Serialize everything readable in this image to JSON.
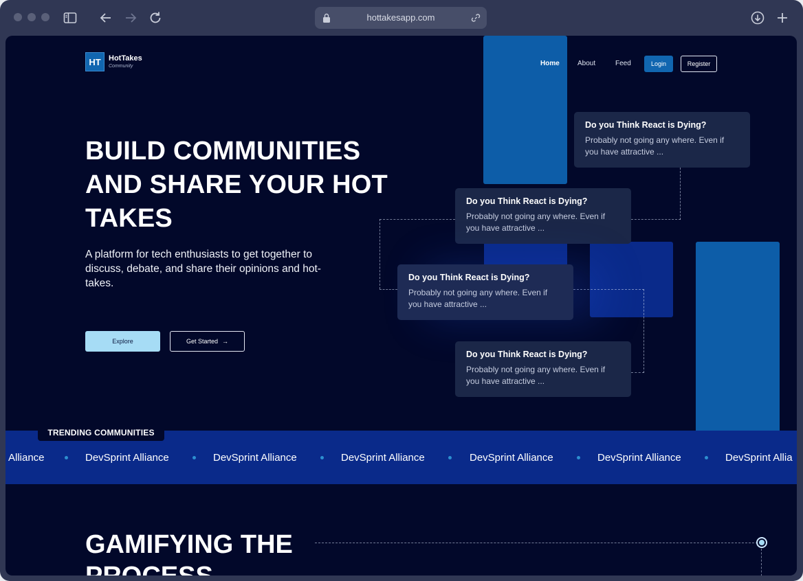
{
  "browser": {
    "url": "hottakesapp.com",
    "icons": [
      "sidebar-icon",
      "back-icon",
      "forward-icon",
      "reload-icon",
      "lock-icon",
      "link-icon",
      "download-icon",
      "new-tab-icon"
    ]
  },
  "header": {
    "logo_mark": "HT",
    "logo_name": "HotTakes",
    "logo_sub": "Community",
    "nav": [
      {
        "label": "Home",
        "active": true
      },
      {
        "label": "About",
        "active": false
      },
      {
        "label": "Feed",
        "active": false
      }
    ],
    "login_label": "Login",
    "register_label": "Register"
  },
  "hero": {
    "title": "BUILD COMMUNITIES AND SHARE YOUR HOT TAKES",
    "subtitle": "A platform for tech enthusiasts to get together to discuss, debate, and share their opinions and hot-takes.",
    "explore_label": "Explore",
    "get_started_label": "Get Started",
    "get_started_icon": "→"
  },
  "cards": [
    {
      "title": "Do you Think React is Dying?",
      "body": "Probably not going any where. Even if you have attractive ..."
    },
    {
      "title": "Do you Think React is Dying?",
      "body": "Probably not going any where. Even if you have attractive ..."
    },
    {
      "title": "Do you Think React is Dying?",
      "body": "Probably not going any where. Even if you have attractive ..."
    },
    {
      "title": "Do you Think React is Dying?",
      "body": "Probably not going any where. Even if you have attractive ..."
    }
  ],
  "trending": {
    "label": "TRENDING COMMUNITIES",
    "items": [
      "Alliance",
      "DevSprint Alliance",
      "DevSprint Alliance",
      "DevSprint Alliance",
      "DevSprint Alliance",
      "DevSprint Alliance",
      "DevSprint Allia"
    ]
  },
  "gamifying": {
    "title": "GAMIFYING THE PROCESS"
  },
  "colors": {
    "page_bg": "#02082a",
    "accent": "#1166b0",
    "band": "#0a2a8a",
    "light_button": "#a6dcf5"
  }
}
